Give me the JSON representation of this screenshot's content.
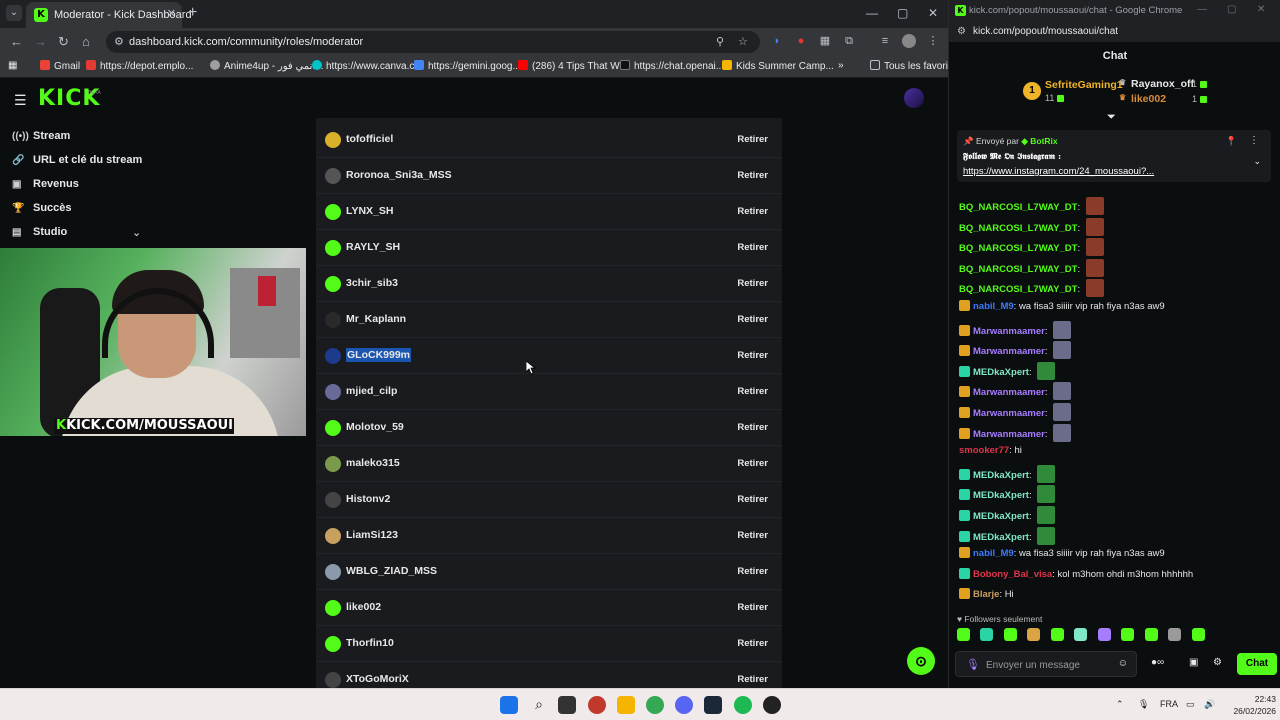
{
  "left_window": {
    "tab_title": "Moderator - Kick Dashboard",
    "url": "dashboard.kick.com/community/roles/moderator",
    "bookmarks": [
      {
        "label": "Gmail",
        "color": "#ea4335"
      },
      {
        "label": "https://depot.emplo...",
        "color": "#e53935"
      },
      {
        "label": "Anime4up - انمي فور...",
        "color": "#9e9e9e"
      },
      {
        "label": "https://www.canva.c...",
        "color": "#00c4cc"
      },
      {
        "label": "https://gemini.goog...",
        "color": "#4285f4"
      },
      {
        "label": "(286) 4 Tips That Wi...",
        "color": "#ff0000"
      },
      {
        "label": "https://chat.openai...",
        "color": "#202124"
      },
      {
        "label": "Kids Summer Camp...",
        "color": "#f4b400"
      }
    ],
    "bookmarks_folder": "Tous les favoris"
  },
  "sidebar": {
    "items": [
      {
        "label": "Stream",
        "icon": "broadcast-icon"
      },
      {
        "label": "URL et clé du stream",
        "icon": "link-icon"
      },
      {
        "label": "Revenus",
        "icon": "revenue-icon"
      },
      {
        "label": "Succès",
        "icon": "trophy-icon"
      },
      {
        "label": "Studio",
        "icon": "studio-icon"
      }
    ]
  },
  "webcam": {
    "banner": "KICK.COM/MOUSSAOUI"
  },
  "moderators": {
    "remove_label": "Retirer",
    "rows": [
      {
        "name": "tofofficiel",
        "avatar": "#d9b02a"
      },
      {
        "name": "Roronoa_Sni3a_MSS",
        "avatar": "#555555"
      },
      {
        "name": "LYNX_SH",
        "avatar": "#53fc18"
      },
      {
        "name": "RAYLY_SH",
        "avatar": "#53fc18"
      },
      {
        "name": "3chir_sib3",
        "avatar": "#53fc18"
      },
      {
        "name": "Mr_Kaplann",
        "avatar": "#2a2a2a"
      },
      {
        "name": "GLoCK999m",
        "avatar": "#1e3a8a"
      },
      {
        "name": "mjied_cilp",
        "avatar": "#6b6b9a"
      },
      {
        "name": "Molotov_59",
        "avatar": "#53fc18"
      },
      {
        "name": "maleko315",
        "avatar": "#7a9a4a"
      },
      {
        "name": "Histonv2",
        "avatar": "#444444"
      },
      {
        "name": "LiamSi123",
        "avatar": "#c8a060"
      },
      {
        "name": "WBLG_ZIAD_MSS",
        "avatar": "#8a9aaa"
      },
      {
        "name": "like002",
        "avatar": "#53fc18"
      },
      {
        "name": "Thorfin10",
        "avatar": "#53fc18"
      },
      {
        "name": "XToGoMoriX",
        "avatar": "#444444"
      }
    ]
  },
  "right_window": {
    "title": "kick.com/popout/moussaoui/chat - Google Chrome",
    "url": "kick.com/popout/moussaoui/chat",
    "header": "Chat"
  },
  "leaderboard": {
    "top": {
      "name": "SefriteGaming1",
      "count": "11",
      "rank": "1"
    },
    "second": {
      "name": "Rayanox_off",
      "count": "1"
    },
    "third": {
      "name": "like002",
      "count": "1"
    }
  },
  "pinned": {
    "sent_by_label": "Envoyé par",
    "sent_by_user": "BotRix",
    "text": "𝕱𝖔𝖑𝖑𝖔𝖜 𝕸𝖊 𝕺𝖓 𝕴𝖓𝖘𝖙𝖆𝖌𝖗𝖆𝖒 :",
    "link": "https://www.instagram.com/24_moussaoui?..."
  },
  "chat": {
    "messages": [
      {
        "user": "BQ_NARCOSI_L7WAY_DT",
        "color": "#53fc18",
        "text": "",
        "emote": true,
        "badge": ""
      },
      {
        "user": "BQ_NARCOSI_L7WAY_DT",
        "color": "#53fc18",
        "text": "",
        "emote": true,
        "badge": ""
      },
      {
        "user": "BQ_NARCOSI_L7WAY_DT",
        "color": "#53fc18",
        "text": "",
        "emote": true,
        "badge": ""
      },
      {
        "user": "BQ_NARCOSI_L7WAY_DT",
        "color": "#53fc18",
        "text": "",
        "emote": true,
        "badge": ""
      },
      {
        "user": "BQ_NARCOSI_L7WAY_DT",
        "color": "#53fc18",
        "text": "",
        "emote": true,
        "badge": ""
      },
      {
        "user": "nabil_M9",
        "color": "#3d7bff",
        "text": "wa fisa3 siiiir vip rah fiya n3as aw9",
        "emote": false,
        "badge": "#e0a020"
      },
      {
        "user": "Marwanmaamer",
        "color": "#a77dff",
        "text": "",
        "emote": true,
        "badge": "#e0a020"
      },
      {
        "user": "Marwanmaamer",
        "color": "#a77dff",
        "text": "",
        "emote": true,
        "badge": "#e0a020"
      },
      {
        "user": "MEDkaXpert",
        "color": "#7fe8c8",
        "text": "",
        "emote": true,
        "badge": "#2bd4a4"
      },
      {
        "user": "Marwanmaamer",
        "color": "#a77dff",
        "text": "",
        "emote": true,
        "badge": "#e0a020"
      },
      {
        "user": "Marwanmaamer",
        "color": "#a77dff",
        "text": "",
        "emote": true,
        "badge": "#e0a020"
      },
      {
        "user": "Marwanmaamer",
        "color": "#a77dff",
        "text": "",
        "emote": true,
        "badge": "#e0a020"
      },
      {
        "user": "smooker77",
        "color": "#e0344a",
        "text": "hi",
        "emote": false,
        "badge": ""
      },
      {
        "user": "MEDkaXpert",
        "color": "#7fe8c8",
        "text": "",
        "emote": true,
        "badge": "#2bd4a4"
      },
      {
        "user": "MEDkaXpert",
        "color": "#7fe8c8",
        "text": "",
        "emote": true,
        "badge": "#2bd4a4"
      },
      {
        "user": "MEDkaXpert",
        "color": "#7fe8c8",
        "text": "",
        "emote": true,
        "badge": "#2bd4a4"
      },
      {
        "user": "MEDkaXpert",
        "color": "#7fe8c8",
        "text": "",
        "emote": true,
        "badge": "#2bd4a4"
      },
      {
        "user": "nabil_M9",
        "color": "#3d7bff",
        "text": "wa fisa3 siiiir vip rah fiya n3as aw9",
        "emote": false,
        "badge": "#e0a020"
      },
      {
        "user": "Bobony_Bal_visa",
        "color": "#e0344a",
        "text": "kol m3hom ohdi m3hom hhhhhh",
        "emote": false,
        "badge": "#2bd4a4"
      },
      {
        "user": "Blarje",
        "color": "#c8a060",
        "text": "Hi",
        "emote": false,
        "badge": "#e0a020"
      }
    ],
    "followers_only": "Followers seulement",
    "input_placeholder": "Envoyer un message",
    "send_label": "Chat"
  },
  "taskbar": {
    "lang": "FRA",
    "time": "22:43",
    "date": "26/02/2026"
  },
  "colors": {
    "accent": "#53fc18",
    "panel": "#191b1f",
    "background": "#0b0e0f"
  }
}
